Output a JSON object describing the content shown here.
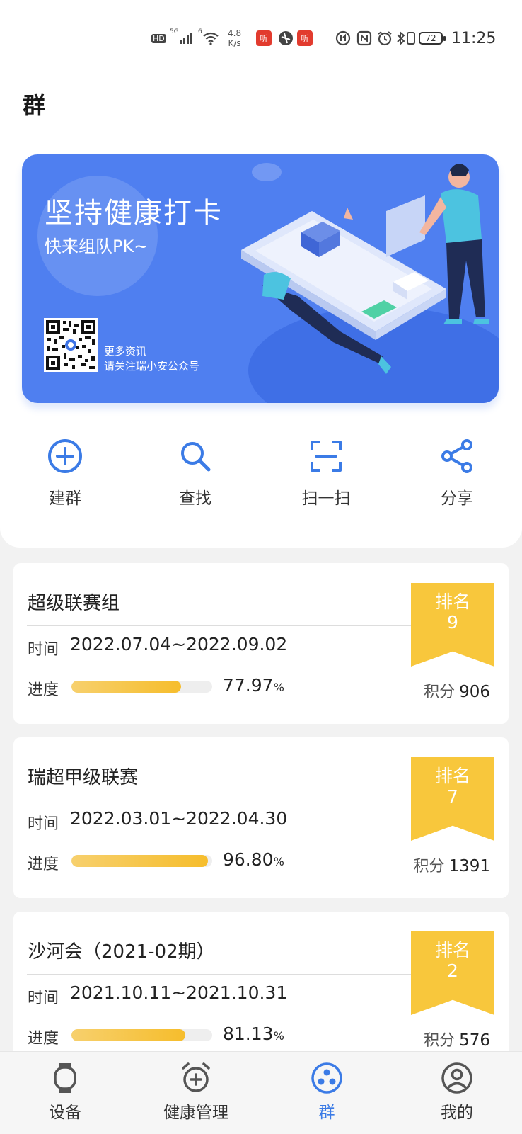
{
  "status_bar": {
    "hd": "HD",
    "signal_5g": "5G",
    "wifi_6": "6",
    "speed_value": "4.8",
    "speed_unit": "K/s",
    "app_badge_1": "听",
    "app_badge_2": "听",
    "battery": "72",
    "time": "11:25"
  },
  "page": {
    "title": "群"
  },
  "banner": {
    "title": "坚持健康打卡",
    "subtitle": "快来组队PK~",
    "note_line1": "更多资讯",
    "note_line2": "请关注瑞小安公众号"
  },
  "actions": [
    {
      "label": "建群",
      "icon": "plus-circle-icon"
    },
    {
      "label": "查找",
      "icon": "search-icon"
    },
    {
      "label": "扫一扫",
      "icon": "scan-icon"
    },
    {
      "label": "分享",
      "icon": "share-icon"
    }
  ],
  "groups": [
    {
      "name": "超级联赛组",
      "time_label": "时间",
      "time_range": "2022.07.04~2022.09.02",
      "progress_label": "进度",
      "progress_value": "77.97",
      "progress_unit": "%",
      "progress_fraction": 0.7797,
      "rank_label": "排名",
      "rank": "9",
      "score_label": "积分",
      "score": "906"
    },
    {
      "name": "瑞超甲级联赛",
      "time_label": "时间",
      "time_range": "2022.03.01~2022.04.30",
      "progress_label": "进度",
      "progress_value": "96.80",
      "progress_unit": "%",
      "progress_fraction": 0.968,
      "rank_label": "排名",
      "rank": "7",
      "score_label": "积分",
      "score": "1391"
    },
    {
      "name": "沙河会（2021-02期）",
      "time_label": "时间",
      "time_range": "2021.10.11~2021.10.31",
      "progress_label": "进度",
      "progress_value": "81.13",
      "progress_unit": "%",
      "progress_fraction": 0.8113,
      "rank_label": "排名",
      "rank": "2",
      "score_label": "积分",
      "score": "576"
    }
  ],
  "bottom_nav": [
    {
      "label": "设备",
      "icon": "watch-icon",
      "active": false
    },
    {
      "label": "健康管理",
      "icon": "health-alarm-icon",
      "active": false
    },
    {
      "label": "群",
      "icon": "group-icon",
      "active": true
    },
    {
      "label": "我的",
      "icon": "profile-icon",
      "active": false
    }
  ],
  "colors": {
    "accent": "#3b7be6",
    "banner": "#4f7ff0",
    "ribbon": "#f8c73c",
    "progress": "#f6bd2c"
  }
}
